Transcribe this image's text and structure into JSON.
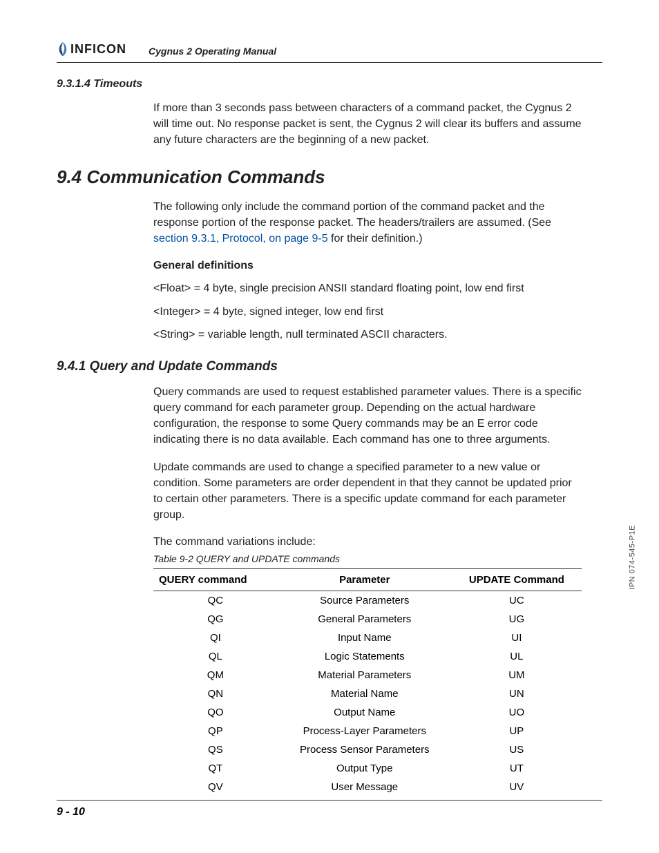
{
  "header": {
    "brand": "INFICON",
    "doc_title": "Cygnus 2 Operating Manual"
  },
  "sec_9314": {
    "heading": "9.3.1.4  Timeouts",
    "p1": "If more than 3 seconds pass between characters of a command packet, the Cygnus 2 will time out. No response packet is sent, the Cygnus 2 will clear its buffers and assume any future characters are the beginning of a new packet."
  },
  "sec_94": {
    "heading": "9.4  Communication Commands",
    "p1a": "The following only include the command portion of the command packet and the response portion of the response packet. The headers/trailers are assumed. (See ",
    "p1_link": "section 9.3.1, Protocol, on page 9-5",
    "p1b": " for their definition.)",
    "gd_heading": "General definitions",
    "gd1": "<Float> = 4 byte, single precision ANSII standard floating point, low end first",
    "gd2": "<Integer> = 4 byte, signed integer, low end first",
    "gd3": "<String> = variable length, null terminated ASCII characters."
  },
  "sec_941": {
    "heading": "9.4.1  Query and Update Commands",
    "p1": "Query commands are used to request established parameter values. There is a specific query command for each parameter group. Depending on the actual hardware configuration, the response to some Query commands may be an E error code indicating there is no data available. Each command has one to three arguments.",
    "p2": "Update commands are used to change a specified parameter to a new value or condition. Some parameters are order dependent in that they cannot be updated prior to certain other parameters. There is a specific update command for each parameter group.",
    "p3": "The command variations include:"
  },
  "table": {
    "caption": "Table 9-2  QUERY and UPDATE commands",
    "headers": {
      "c1": "QUERY command",
      "c2": "Parameter",
      "c3": "UPDATE Command"
    },
    "rows": [
      {
        "q": "QC",
        "p": "Source Parameters",
        "u": "UC"
      },
      {
        "q": "QG",
        "p": "General Parameters",
        "u": "UG"
      },
      {
        "q": "QI",
        "p": "Input Name",
        "u": "UI"
      },
      {
        "q": "QL",
        "p": "Logic Statements",
        "u": "UL"
      },
      {
        "q": "QM",
        "p": "Material Parameters",
        "u": "UM"
      },
      {
        "q": "QN",
        "p": "Material Name",
        "u": "UN"
      },
      {
        "q": "QO",
        "p": "Output Name",
        "u": "UO"
      },
      {
        "q": "QP",
        "p": "Process-Layer Parameters",
        "u": "UP"
      },
      {
        "q": "QS",
        "p": "Process Sensor Parameters",
        "u": "US"
      },
      {
        "q": "QT",
        "p": "Output Type",
        "u": "UT"
      },
      {
        "q": "QV",
        "p": "User Message",
        "u": "UV"
      }
    ]
  },
  "footer": {
    "page": "9 - 10",
    "ipn": "IPN 074-545-P1E"
  }
}
